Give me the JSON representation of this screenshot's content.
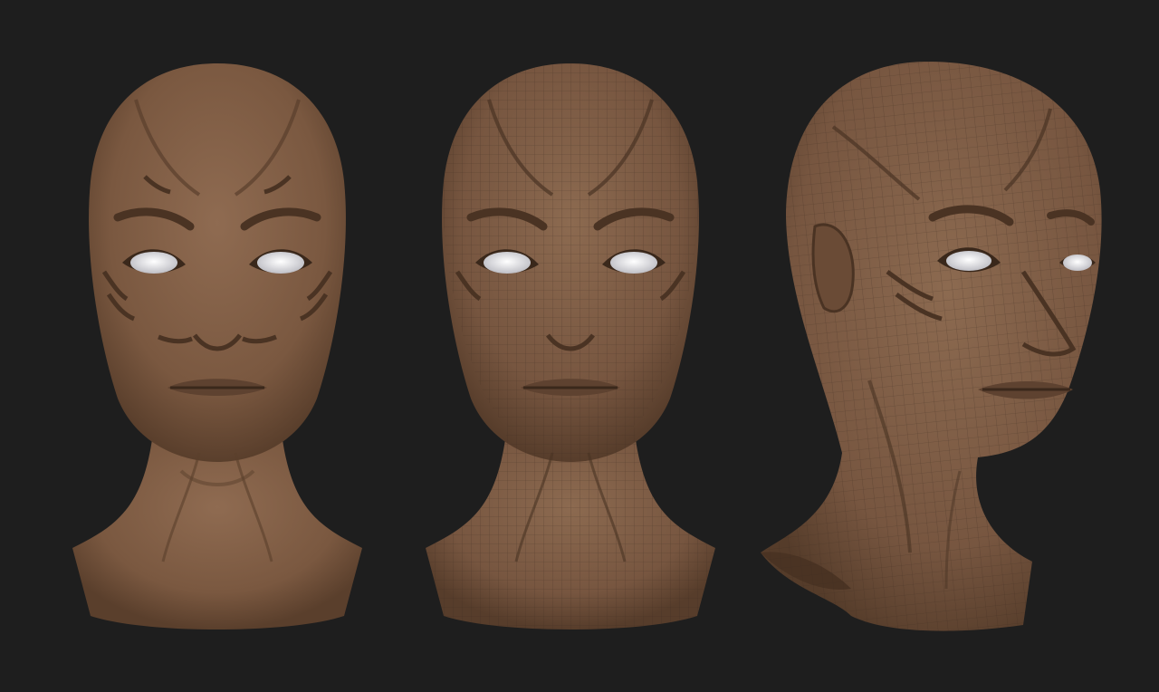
{
  "scene": {
    "background": "#1e1e1e",
    "skin_color": "#7e5c44",
    "eye_color": "#e8e8ec",
    "views": [
      {
        "id": "front-smooth",
        "wireframe": false
      },
      {
        "id": "front-wireframe",
        "wireframe": true
      },
      {
        "id": "three-quarter-wireframe",
        "wireframe": true
      }
    ]
  }
}
